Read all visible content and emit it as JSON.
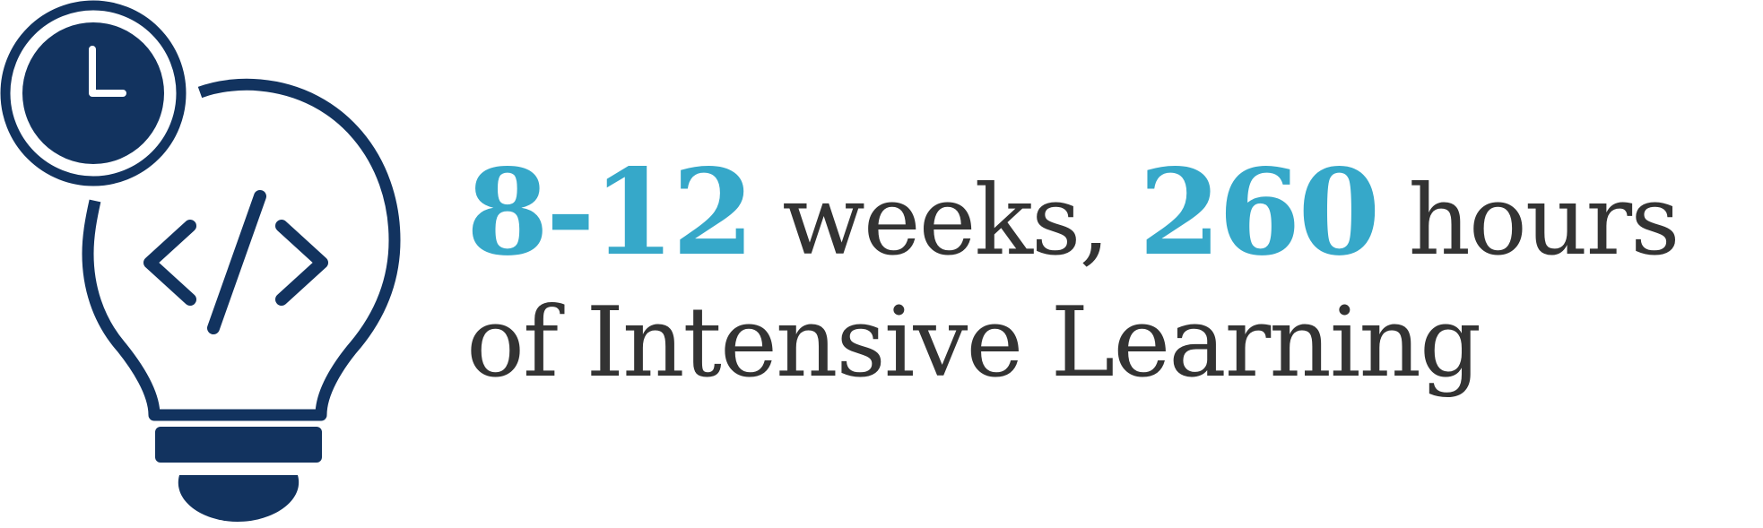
{
  "icon": {
    "name": "lightbulb-code-clock-icon",
    "colors": {
      "primary": "#12335f",
      "accent": "#36a8c9",
      "text": "#333333",
      "background": "#ffffff"
    }
  },
  "headline": {
    "duration_value": "8-12",
    "duration_unit": "weeks,",
    "hours_value": "260",
    "hours_unit": "hours",
    "line2": "of Intensive Learning"
  }
}
